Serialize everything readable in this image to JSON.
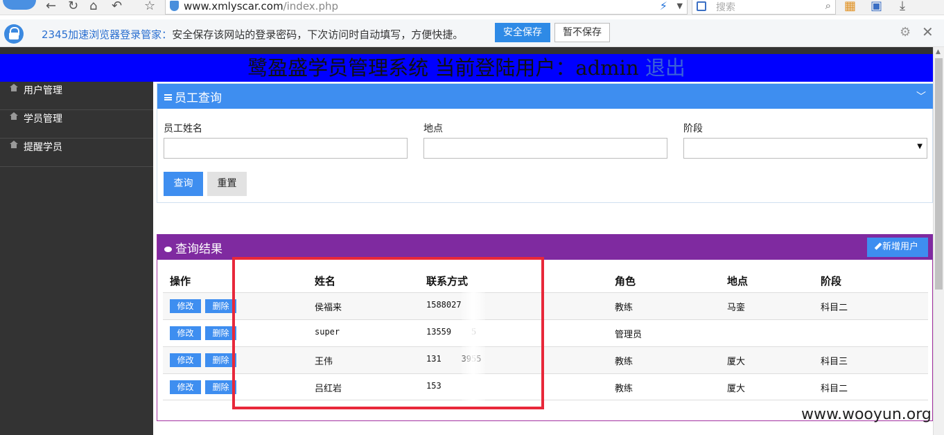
{
  "browser": {
    "url_domain": "www.xmlyscar.com",
    "url_path": "/index.php",
    "search_placeholder": "搜索"
  },
  "password_bar": {
    "brand": "2345加速浏览器登录管家：",
    "message": "安全保存该网站的登录密码，下次访问时自动填写，方便快捷。",
    "save_label": "安全保存",
    "nosave_label": "暂不保存"
  },
  "header": {
    "title": "鹭盈盛学员管理系统 当前登陆用户：admin ",
    "logout": "退出"
  },
  "sidebar": {
    "items": [
      {
        "label": "用户管理"
      },
      {
        "label": "学员管理"
      },
      {
        "label": "提醒学员"
      }
    ]
  },
  "query": {
    "title": "员工查询",
    "name_label": "员工姓名",
    "location_label": "地点",
    "stage_label": "阶段",
    "search_label": "查询",
    "reset_label": "重置"
  },
  "results": {
    "title": "查询结果",
    "add_label": "新增用户",
    "columns": [
      "操作",
      "姓名",
      "联系方式",
      "角色",
      "地点",
      "阶段"
    ],
    "edit_label": "修改",
    "delete_label": "删除",
    "rows": [
      {
        "name": "侯福来",
        "phone": "1588027",
        "role": "教练",
        "location": "马銮",
        "stage": "科目二"
      },
      {
        "name": "super",
        "phone": "13559    5",
        "role": "管理员",
        "location": "",
        "stage": ""
      },
      {
        "name": "王伟",
        "phone": "131    3955",
        "role": "教练",
        "location": "厦大",
        "stage": "科目三"
      },
      {
        "name": "吕红岩",
        "phone": "153",
        "role": "教练",
        "location": "厦大",
        "stage": "科目二"
      }
    ]
  },
  "watermark": "www.wooyun.org",
  "colors": {
    "header_bg": "#0000ff",
    "query_head": "#3e8ef0",
    "results_head": "#7f2aa0",
    "highlight_box": "#e8283a"
  }
}
